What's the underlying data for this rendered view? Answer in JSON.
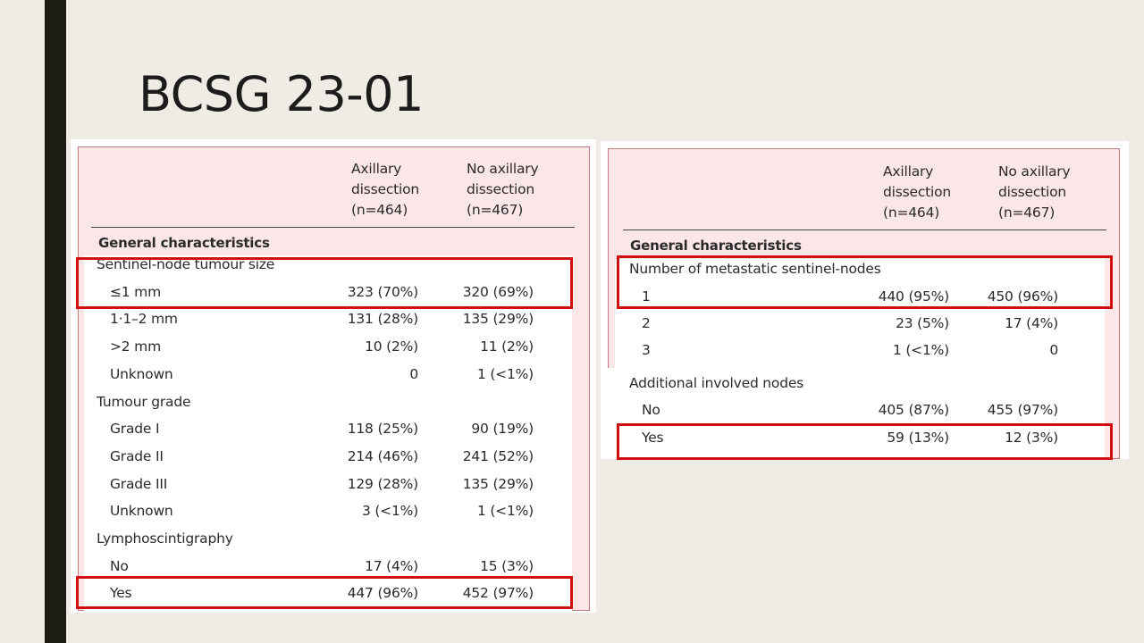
{
  "slide": {
    "title": "BCSG 23-01"
  },
  "table_left": {
    "col_headers": [
      [
        "Axillary",
        "dissection",
        "(n=464)"
      ],
      [
        "No axillary",
        "dissection",
        "(n=467)"
      ]
    ],
    "section_title": "General characteristics",
    "rows": [
      {
        "label": "Sentinel-node tumour size",
        "group": true,
        "a": "",
        "b": ""
      },
      {
        "label": "≤1 mm",
        "group": false,
        "a": "323 (70%)",
        "b": "320 (69%)"
      },
      {
        "label": "1·1–2 mm",
        "group": false,
        "a": "131 (28%)",
        "b": "135 (29%)"
      },
      {
        "label": ">2 mm",
        "group": false,
        "a": "10 (2%)",
        "b": "11 (2%)"
      },
      {
        "label": "Unknown",
        "group": false,
        "a": "0",
        "b": "1 (<1%)"
      },
      {
        "label": "Tumour grade",
        "group": true,
        "a": "",
        "b": ""
      },
      {
        "label": "Grade I",
        "group": false,
        "a": "118 (25%)",
        "b": "90 (19%)"
      },
      {
        "label": "Grade II",
        "group": false,
        "a": "214 (46%)",
        "b": "241 (52%)"
      },
      {
        "label": "Grade III",
        "group": false,
        "a": "129 (28%)",
        "b": "135 (29%)"
      },
      {
        "label": "Unknown",
        "group": false,
        "a": "3 (<1%)",
        "b": "1 (<1%)"
      },
      {
        "label": "Lymphoscintigraphy",
        "group": true,
        "a": "",
        "b": ""
      },
      {
        "label": "No",
        "group": false,
        "a": "17 (4%)",
        "b": "15 (3%)"
      },
      {
        "label": "Yes",
        "group": false,
        "a": "447 (96%)",
        "b": "452 (97%)"
      }
    ]
  },
  "table_right": {
    "col_headers": [
      [
        "Axillary",
        "dissection",
        "(n=464)"
      ],
      [
        "No axillary",
        "dissection",
        "(n=467)"
      ]
    ],
    "section_title": "General characteristics",
    "rows": [
      {
        "label": "Number of metastatic sentinel-nodes",
        "group": true,
        "a": "",
        "b": ""
      },
      {
        "label": "1",
        "group": false,
        "a": "440 (95%)",
        "b": "450 (96%)"
      },
      {
        "label": "2",
        "group": false,
        "a": "23 (5%)",
        "b": "17 (4%)"
      },
      {
        "label": "3",
        "group": false,
        "a": "1 (<1%)",
        "b": "0"
      },
      {
        "label": "Additional involved nodes",
        "group": true,
        "a": "",
        "b": ""
      },
      {
        "label": "No",
        "group": false,
        "a": "405 (87%)",
        "b": "455 (97%)"
      },
      {
        "label": "Yes",
        "group": false,
        "a": "59 (13%)",
        "b": "12 (3%)"
      }
    ]
  }
}
